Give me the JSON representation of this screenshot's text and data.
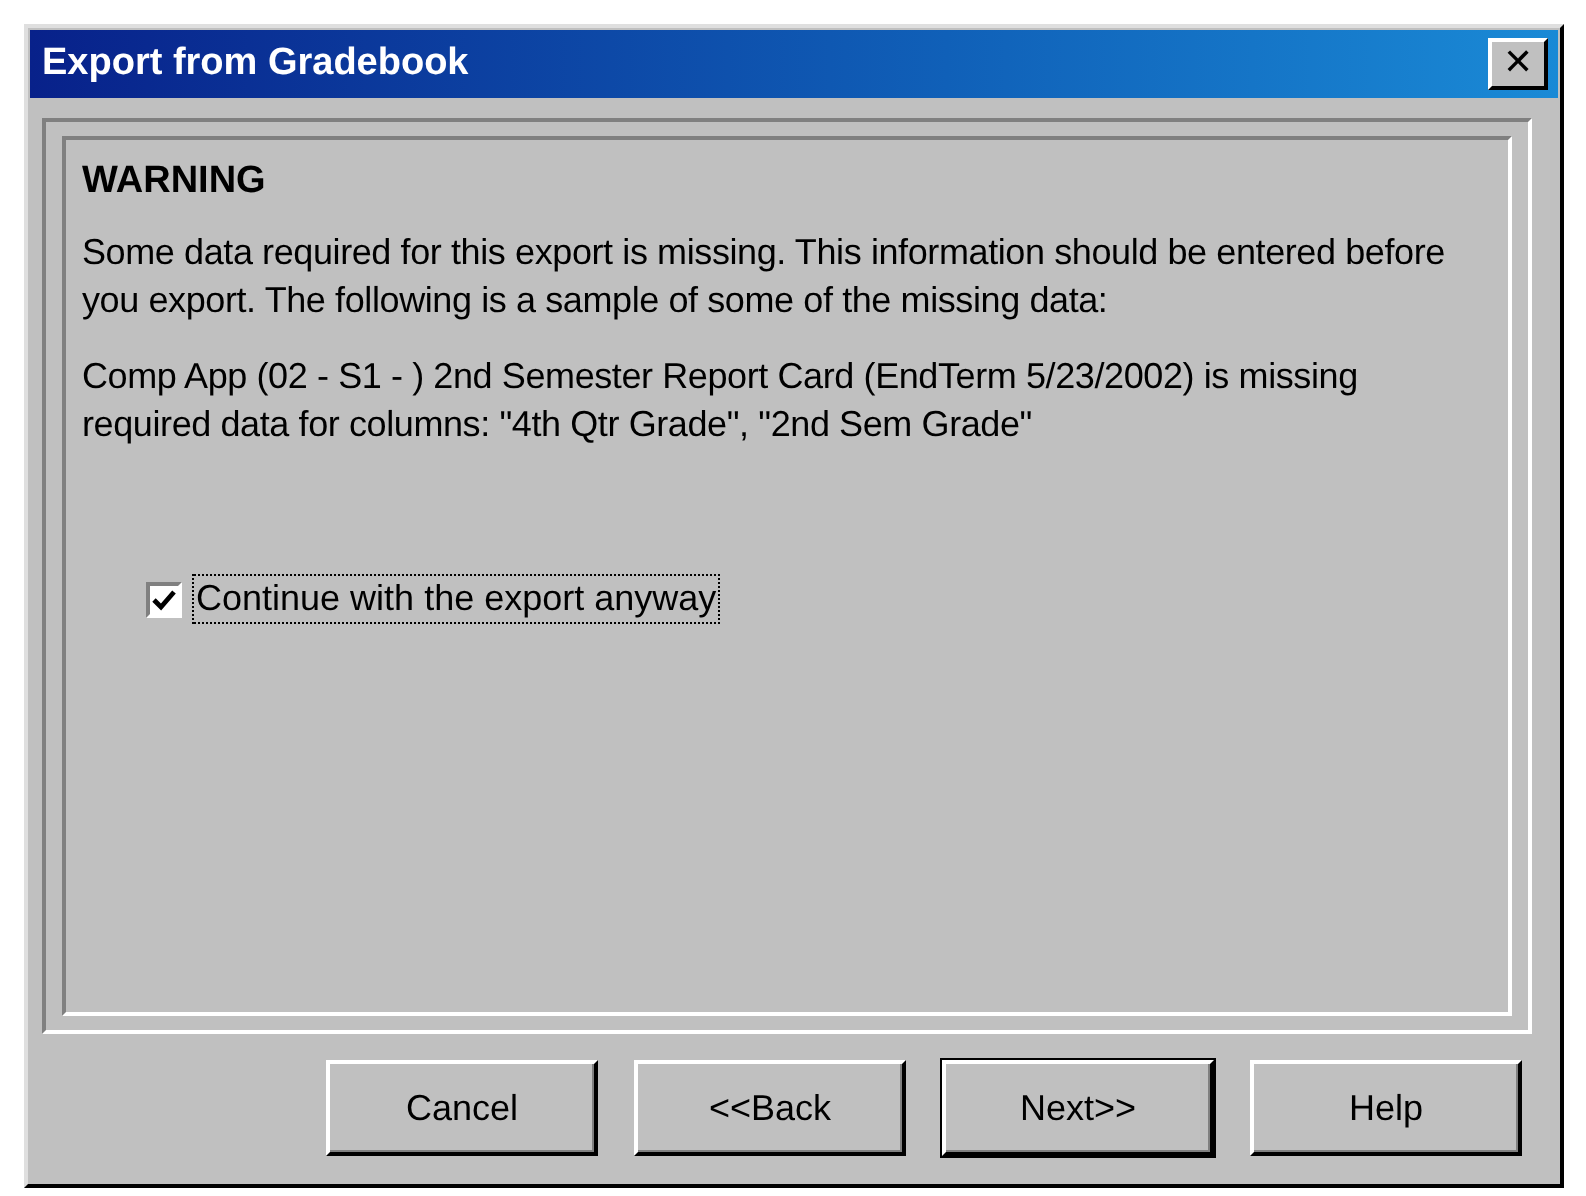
{
  "window": {
    "title": "Export from Gradebook",
    "close_glyph": "✕"
  },
  "warning": {
    "heading": "WARNING",
    "message": "Some data required for this export is missing. This information should be entered before you export.  The following is a sample of some of the missing data:",
    "detail": "Comp App (02 - S1 - ) 2nd Semester Report Card (EndTerm 5/23/2002) is missing required data for columns: \"4th Qtr Grade\", \"2nd Sem Grade\""
  },
  "checkbox": {
    "label": "Continue with the export anyway",
    "checked": true,
    "focused": true
  },
  "buttons": [
    {
      "label": "Cancel",
      "default": false
    },
    {
      "label": "<<Back",
      "default": false
    },
    {
      "label": "Next>>",
      "default": true
    },
    {
      "label": "Help",
      "default": false
    }
  ]
}
